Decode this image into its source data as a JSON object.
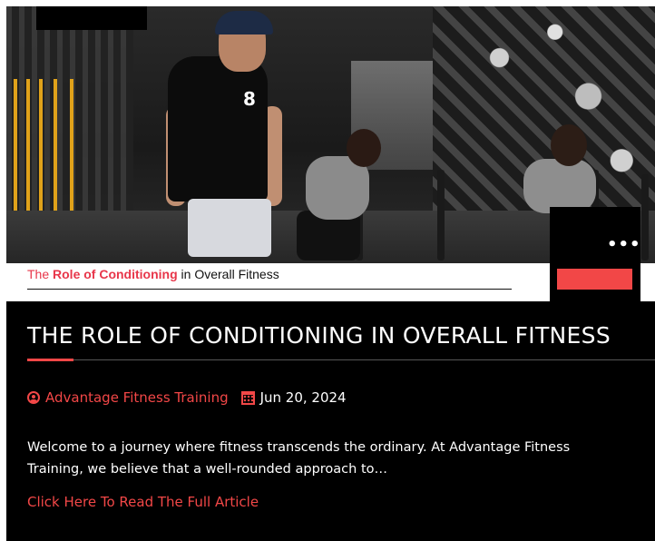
{
  "hero": {
    "image_alt_shown": "",
    "chest_logo": "8"
  },
  "caption": {
    "prefix": "The ",
    "highlight": "Role of Conditioning",
    "suffix": " in Overall Fitness"
  },
  "overlay": {
    "menu_dots": "•••",
    "button_label": ""
  },
  "article": {
    "title": "THE ROLE OF CONDITIONING IN OVERALL FITNESS",
    "author": "Advantage Fitness Training",
    "date": "Jun 20, 2024",
    "excerpt": "Welcome to a journey where fitness transcends the ordinary. At Advantage Fitness Training, we believe that a well-rounded approach to…",
    "read_more": "Click Here To Read The Full Article"
  },
  "colors": {
    "accent": "#f24747",
    "background": "#000000",
    "text": "#ffffff"
  },
  "icons": {
    "author": "user-circle-icon",
    "date": "calendar-icon",
    "menu": "more-dots-icon"
  }
}
